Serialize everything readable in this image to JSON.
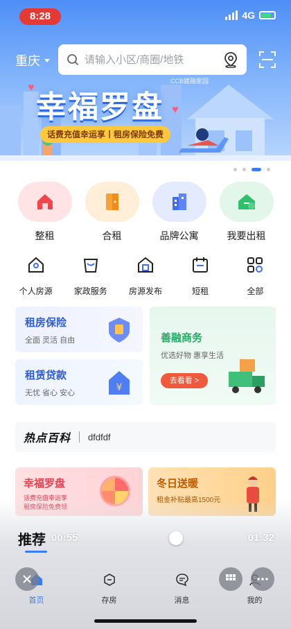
{
  "status": {
    "time": "8:28",
    "network": "4G"
  },
  "header": {
    "city": "重庆",
    "search_placeholder": "请输入小区/商圈/地铁"
  },
  "banner": {
    "title": "幸福罗盘",
    "tagline": "话费充值幸运享丨租房保险免费",
    "brand": "CCB建融家园"
  },
  "primary_nav": [
    {
      "label": "整租",
      "icon": "house-icon",
      "color": "#f0474f",
      "bg": "#ffe3e5"
    },
    {
      "label": "合租",
      "icon": "door-icon",
      "color": "#f5a23a",
      "bg": "#ffefd9"
    },
    {
      "label": "品牌公寓",
      "icon": "building-icon",
      "color": "#3e6ef2",
      "bg": "#e4ebff"
    },
    {
      "label": "我要出租",
      "icon": "house-plus-icon",
      "color": "#2fbf6e",
      "bg": "#e2f7ea"
    }
  ],
  "secondary_nav": [
    {
      "label": "个人房源",
      "icon": "personal-house-icon"
    },
    {
      "label": "家政服务",
      "icon": "bucket-icon"
    },
    {
      "label": "房源发布",
      "icon": "publish-house-icon"
    },
    {
      "label": "短租",
      "icon": "calendar-icon"
    },
    {
      "label": "全部",
      "icon": "grid-icon"
    }
  ],
  "service_cards": {
    "insurance": {
      "title": "租房保险",
      "subtitle": "全面  灵活  自由"
    },
    "loan": {
      "title": "租赁贷款",
      "subtitle": "无忧  省心  安心"
    },
    "shop": {
      "title": "善融商务",
      "subtitle": "优选好物  惠享生活",
      "button": "去看看 >"
    }
  },
  "hot": {
    "title": "热点百科",
    "text": "dfdfdf"
  },
  "promos": [
    {
      "title": "幸福罗盘",
      "subtitle": "话费充值幸运享\n租房保险免费领"
    },
    {
      "title": "冬日送暖",
      "subtitle": "租金补贴最高1500元"
    }
  ],
  "player": {
    "section": "推荐",
    "current": "00:55",
    "total": "01:32",
    "progress": 0.6
  },
  "tabs": [
    {
      "label": "首页",
      "icon": "home-icon",
      "active": true
    },
    {
      "label": "存房",
      "icon": "minus-circle-icon",
      "active": false
    },
    {
      "label": "消息",
      "icon": "chat-icon",
      "active": false
    },
    {
      "label": "我的",
      "icon": "user-icon",
      "active": false
    }
  ]
}
